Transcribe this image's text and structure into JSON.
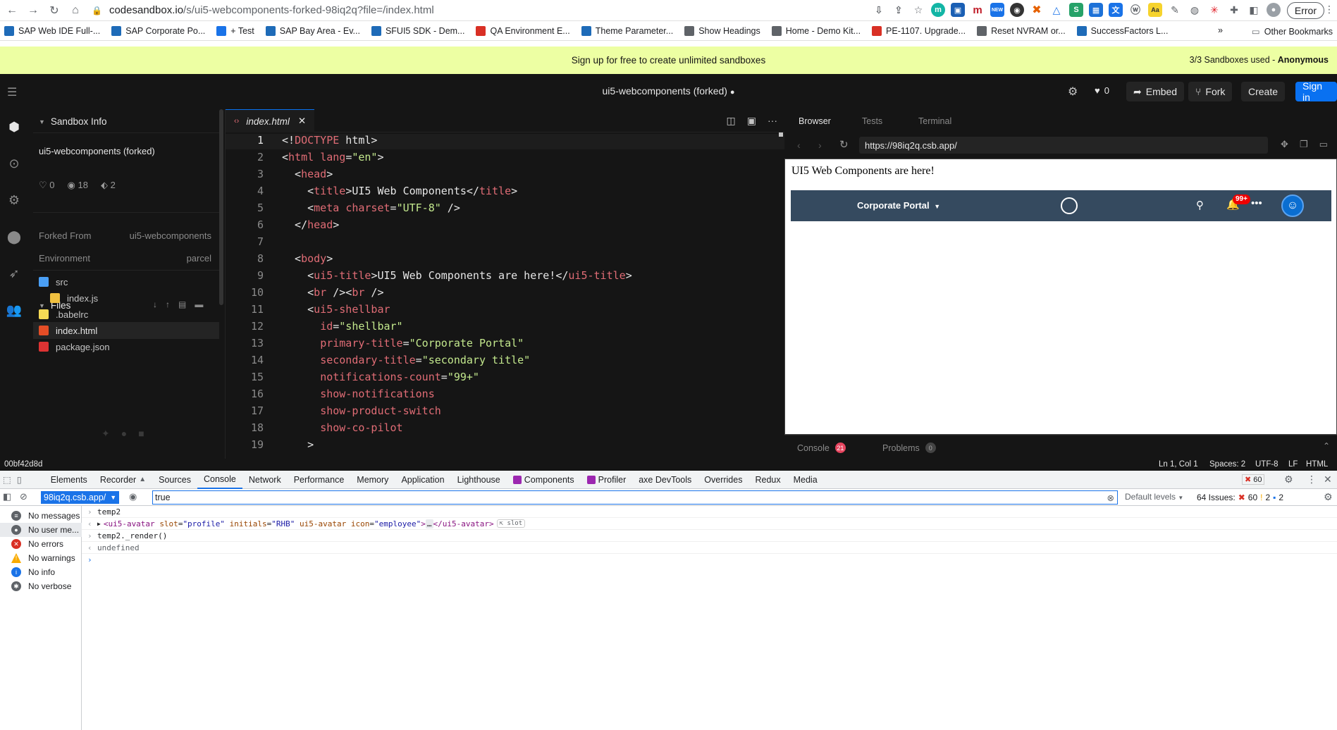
{
  "browser": {
    "url_host": "codesandbox.io",
    "url_path": "/s/ui5-webcomponents-forked-98iq2q?file=/index.html",
    "error_pill": "Error",
    "ext_badge": "NEW",
    "bookmarks": [
      {
        "label": "SAP Web IDE Full-...",
        "color": "#1e6bb8"
      },
      {
        "label": "SAP Corporate Po...",
        "color": "#1e6bb8"
      },
      {
        "label": "+ Test",
        "color": "#1a73e8"
      },
      {
        "label": "SAP Bay Area - Ev...",
        "color": "#1e6bb8"
      },
      {
        "label": "SFUI5 SDK - Dem...",
        "color": "#1e6bb8"
      },
      {
        "label": "QA Environment E...",
        "color": "#d93025"
      },
      {
        "label": "Theme Parameter...",
        "color": "#1e6bb8"
      },
      {
        "label": "Show Headings",
        "color": "#5f6368"
      },
      {
        "label": "Home - Demo Kit...",
        "color": "#5f6368"
      },
      {
        "label": "PE-1107. Upgrade...",
        "color": "#d93025"
      },
      {
        "label": "Reset NVRAM or...",
        "color": "#5f6368"
      },
      {
        "label": "SuccessFactors L...",
        "color": "#1e6bb8"
      }
    ],
    "bookmark_overflow": "»",
    "other_bookmarks": "Other Bookmarks"
  },
  "banner": {
    "text": "Sign up for free to create unlimited sandboxes",
    "right_prefix": "3/3 Sandboxes used - ",
    "right_user": "Anonymous"
  },
  "header": {
    "title": "ui5-webcomponents (forked)",
    "likes": "0",
    "embed": "Embed",
    "fork": "Fork",
    "create": "Create",
    "signin": "Sign in"
  },
  "sidebar": {
    "info_title": "Sandbox Info",
    "sandbox_name": "ui5-webcomponents (forked)",
    "likes": "0",
    "views": "18",
    "forks": "2",
    "forked_from_label": "Forked From",
    "forked_from_value": "ui5-webcomponents",
    "environment_label": "Environment",
    "environment_value": "parcel",
    "files_title": "Files",
    "files": [
      {
        "name": "src",
        "type": "folder"
      },
      {
        "name": "index.js",
        "type": "js"
      },
      {
        "name": ".babelrc",
        "type": "babel"
      },
      {
        "name": "index.html",
        "type": "html",
        "active": true
      },
      {
        "name": "package.json",
        "type": "json"
      }
    ]
  },
  "editor": {
    "tab_name": "index.html",
    "lines": [
      [
        [
          "t-plain",
          "<!"
        ],
        [
          "t-kw",
          "DOCTYPE"
        ],
        [
          "t-plain",
          " html>"
        ]
      ],
      [
        [
          "t-plain",
          "<"
        ],
        [
          "t-tag",
          "html"
        ],
        [
          "t-plain",
          " "
        ],
        [
          "t-attr",
          "lang"
        ],
        [
          "t-plain",
          "="
        ],
        [
          "t-str",
          "\"en\""
        ],
        [
          "t-plain",
          ">"
        ]
      ],
      [
        [
          "t-plain",
          "  <"
        ],
        [
          "t-tag",
          "head"
        ],
        [
          "t-plain",
          ">"
        ]
      ],
      [
        [
          "t-plain",
          "    <"
        ],
        [
          "t-tag",
          "title"
        ],
        [
          "t-plain",
          ">UI5 Web Components</"
        ],
        [
          "t-tag",
          "title"
        ],
        [
          "t-plain",
          ">"
        ]
      ],
      [
        [
          "t-plain",
          "    <"
        ],
        [
          "t-tag",
          "meta"
        ],
        [
          "t-plain",
          " "
        ],
        [
          "t-attr",
          "charset"
        ],
        [
          "t-plain",
          "="
        ],
        [
          "t-str",
          "\"UTF-8\""
        ],
        [
          "t-plain",
          " />"
        ]
      ],
      [
        [
          "t-plain",
          "  </"
        ],
        [
          "t-tag",
          "head"
        ],
        [
          "t-plain",
          ">"
        ]
      ],
      [
        [
          "t-plain",
          ""
        ]
      ],
      [
        [
          "t-plain",
          "  <"
        ],
        [
          "t-tag",
          "body"
        ],
        [
          "t-plain",
          ">"
        ]
      ],
      [
        [
          "t-plain",
          "    <"
        ],
        [
          "t-tag",
          "ui5-title"
        ],
        [
          "t-plain",
          ">UI5 Web Components are here!</"
        ],
        [
          "t-tag",
          "ui5-title"
        ],
        [
          "t-plain",
          ">"
        ]
      ],
      [
        [
          "t-plain",
          "    <"
        ],
        [
          "t-tag",
          "br"
        ],
        [
          "t-plain",
          " /><"
        ],
        [
          "t-tag",
          "br"
        ],
        [
          "t-plain",
          " />"
        ]
      ],
      [
        [
          "t-plain",
          "    <"
        ],
        [
          "t-tag",
          "ui5-shellbar"
        ]
      ],
      [
        [
          "t-plain",
          "      "
        ],
        [
          "t-attr",
          "id"
        ],
        [
          "t-plain",
          "="
        ],
        [
          "t-str",
          "\"shellbar\""
        ]
      ],
      [
        [
          "t-plain",
          "      "
        ],
        [
          "t-attr",
          "primary-title"
        ],
        [
          "t-plain",
          "="
        ],
        [
          "t-str",
          "\"Corporate Portal\""
        ]
      ],
      [
        [
          "t-plain",
          "      "
        ],
        [
          "t-attr",
          "secondary-title"
        ],
        [
          "t-plain",
          "="
        ],
        [
          "t-str",
          "\"secondary title\""
        ]
      ],
      [
        [
          "t-plain",
          "      "
        ],
        [
          "t-attr",
          "notifications-count"
        ],
        [
          "t-plain",
          "="
        ],
        [
          "t-str",
          "\"99+\""
        ]
      ],
      [
        [
          "t-plain",
          "      "
        ],
        [
          "t-attr",
          "show-notifications"
        ]
      ],
      [
        [
          "t-plain",
          "      "
        ],
        [
          "t-attr",
          "show-product-switch"
        ]
      ],
      [
        [
          "t-plain",
          "      "
        ],
        [
          "t-attr",
          "show-co-pilot"
        ]
      ],
      [
        [
          "t-plain",
          "    >"
        ]
      ]
    ]
  },
  "preview": {
    "tabs": [
      "Browser",
      "Tests",
      "Terminal"
    ],
    "url": "https://98iq2q.csb.app/",
    "page_title": "UI5 Web Components are here!",
    "shellbar_title": "Corporate Portal",
    "notifications_badge": "99+",
    "console_label": "Console",
    "console_count": "21",
    "problems_label": "Problems",
    "problems_count": "0"
  },
  "statusbar": {
    "hash": "00bf42d8d",
    "position": "Ln 1, Col 1",
    "spaces": "Spaces: 2",
    "encoding": "UTF-8",
    "eol": "LF",
    "lang": "HTML"
  },
  "devtools": {
    "tabs": [
      "Elements",
      "Recorder",
      "Sources",
      "Console",
      "Network",
      "Performance",
      "Memory",
      "Application",
      "Lighthouse",
      "Components",
      "Profiler",
      "axe DevTools",
      "Overrides",
      "Redux",
      "Media"
    ],
    "active_tab": "Console",
    "error_count": "60",
    "context": "98iq2q.csb.app/",
    "filter_value": "true",
    "levels": "Default levels",
    "issues_label": "64 Issues:",
    "issues_errors": "60",
    "issues_warnings": "2",
    "issues_info": "2",
    "side_items": [
      {
        "label": "No messages",
        "icon": "list-icon",
        "color": "#5f6368"
      },
      {
        "label": "No user me...",
        "icon": "user-icon",
        "color": "#5f6368"
      },
      {
        "label": "No errors",
        "icon": "error-icon",
        "color": "#d93025"
      },
      {
        "label": "No warnings",
        "icon": "warning-icon",
        "color": "#f9ab00"
      },
      {
        "label": "No info",
        "icon": "info-icon",
        "color": "#1a73e8"
      },
      {
        "label": "No verbose",
        "icon": "bug-icon",
        "color": "#5f6368"
      }
    ],
    "console_lines": {
      "l1": "temp2",
      "l2_tag_open": "<ui5-avatar",
      "l2_attr1": "slot",
      "l2_val1": "\"profile\"",
      "l2_attr2": "initials",
      "l2_val2": "\"RHB\"",
      "l2_attr3": "ui5-avatar",
      "l2_attr4": "icon",
      "l2_val4": "\"employee\"",
      "l2_tag_close": "</ui5-avatar>",
      "l2_ellipsis": "…",
      "l2_slot": "slot",
      "l3": "temp2._render()",
      "l4": "undefined"
    }
  }
}
